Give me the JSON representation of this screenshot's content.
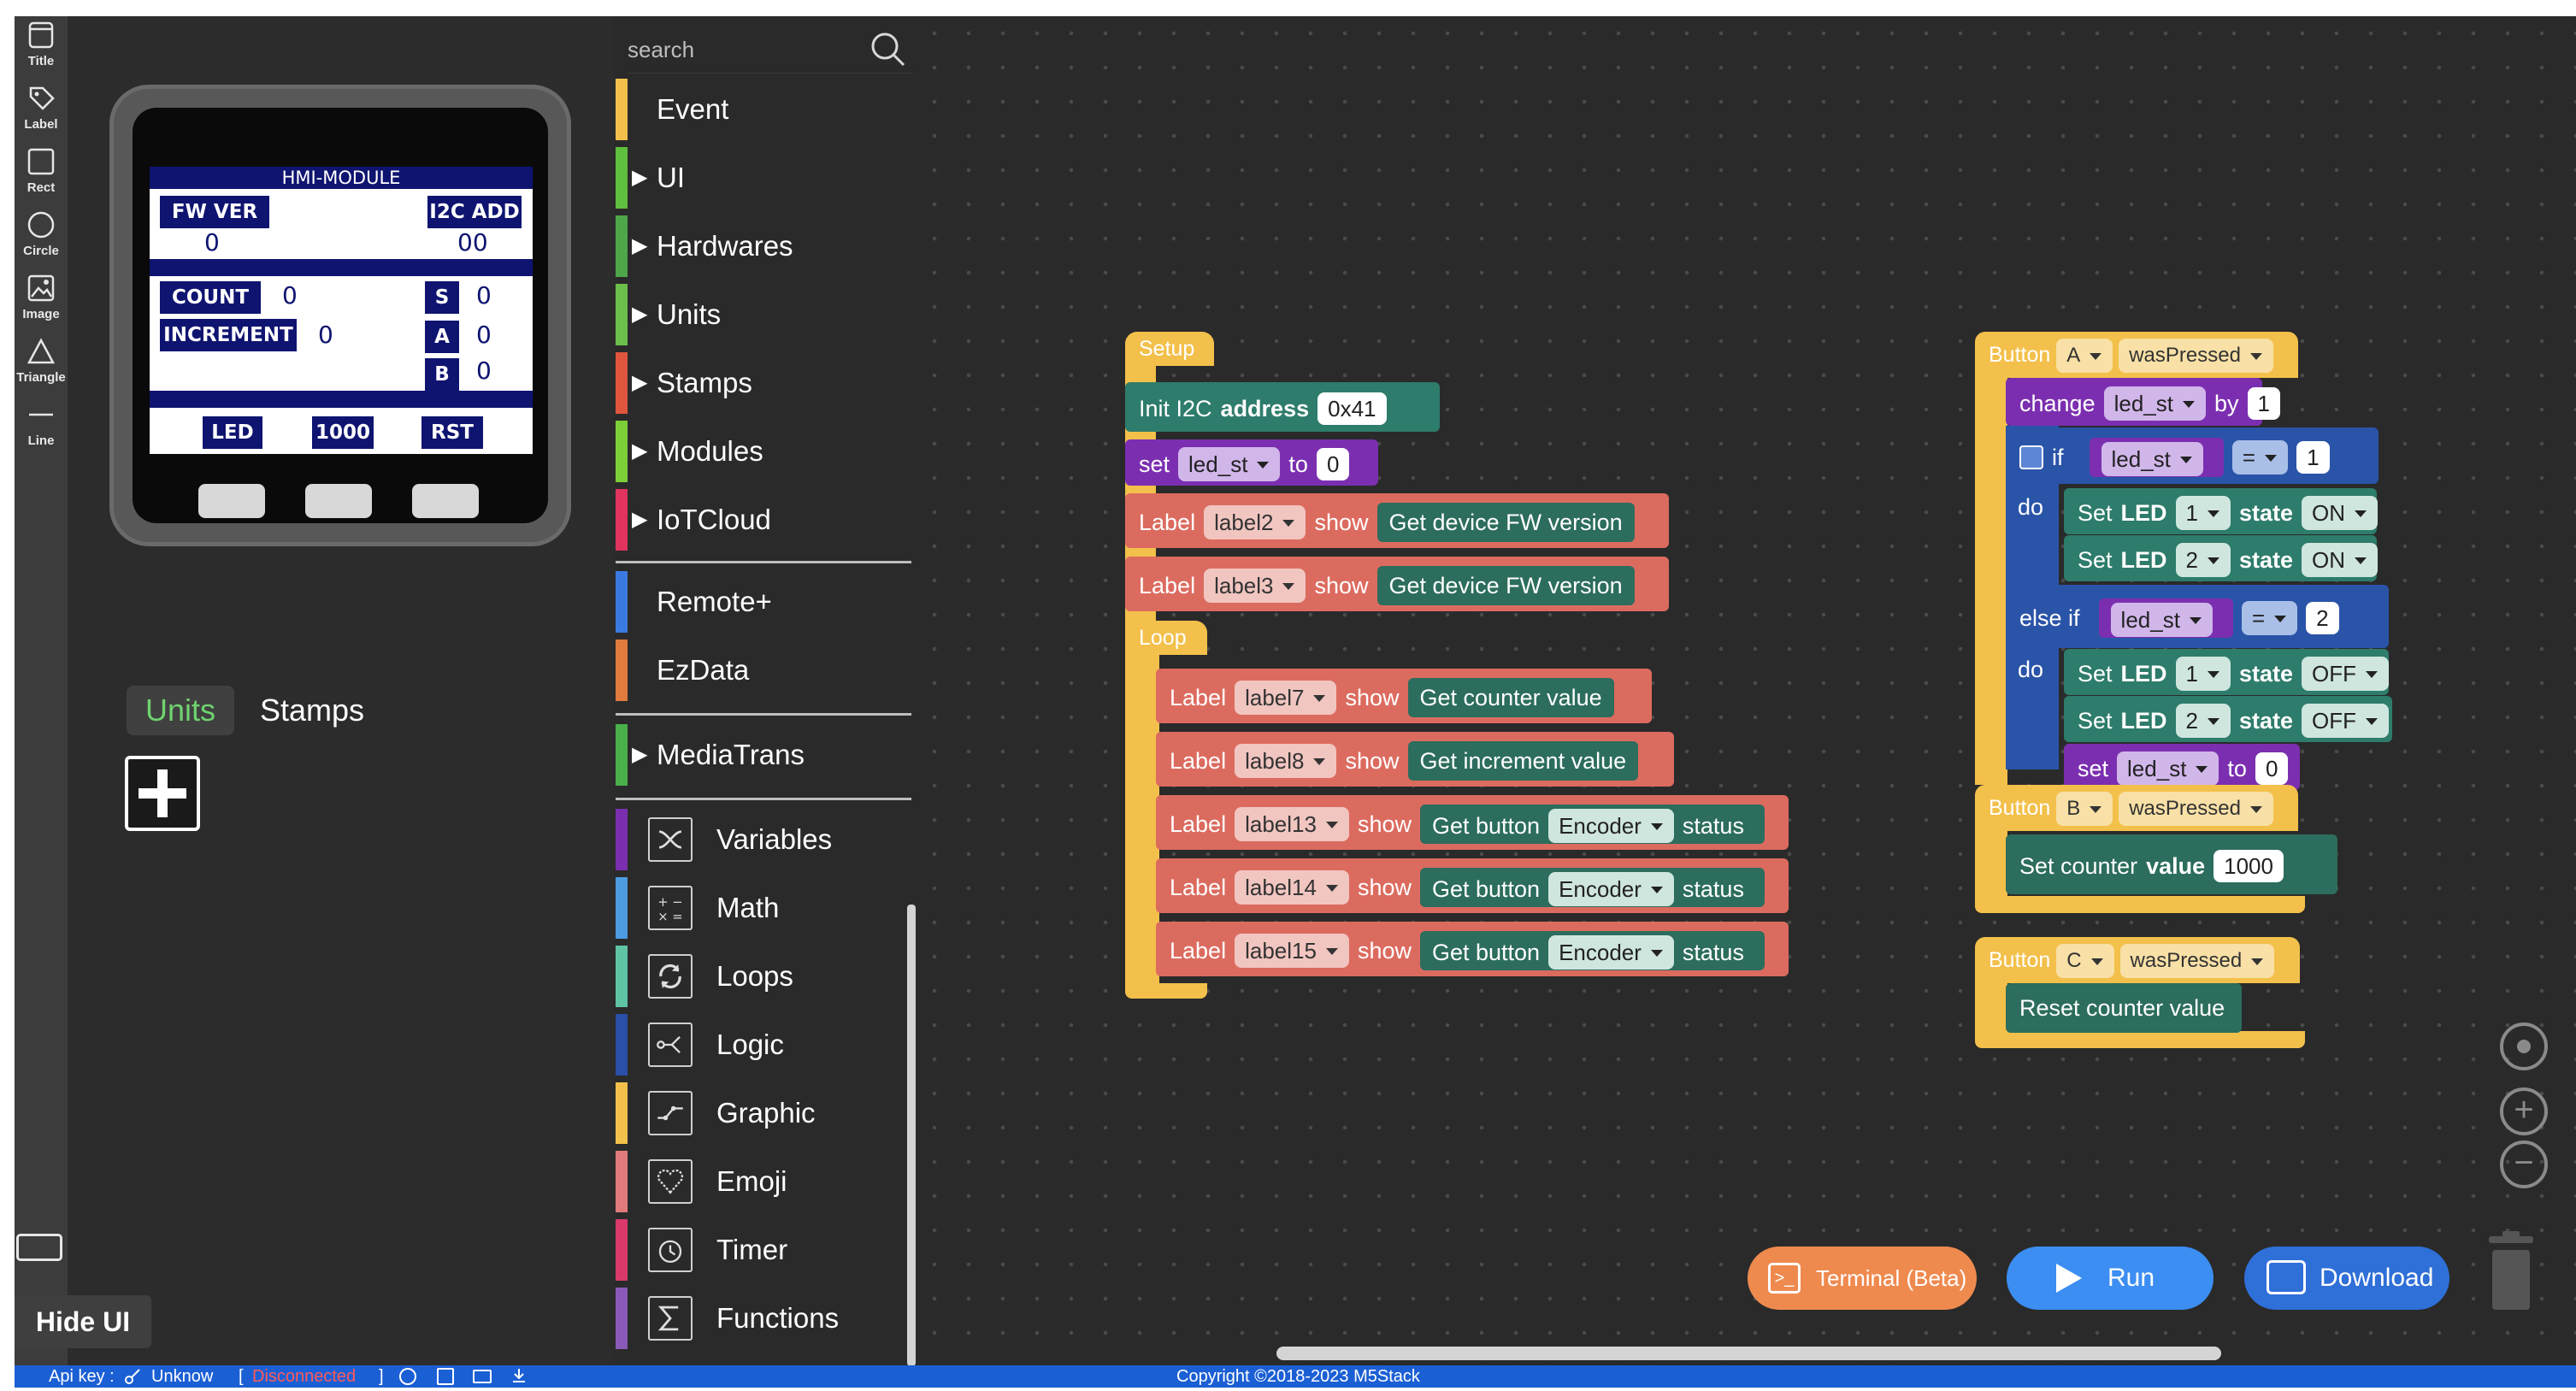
{
  "toolbar": {
    "tools": [
      {
        "label": "Title",
        "icon": "title-icon"
      },
      {
        "label": "Label",
        "icon": "label-icon"
      },
      {
        "label": "Rect",
        "icon": "rect-icon"
      },
      {
        "label": "Circle",
        "icon": "circle-icon"
      },
      {
        "label": "Image",
        "icon": "image-icon"
      },
      {
        "label": "Triangle",
        "icon": "triangle-icon"
      },
      {
        "label": "Line",
        "icon": "line-icon"
      }
    ]
  },
  "device": {
    "title": "HMI-MODULE",
    "fw_ver_label": "FW VER",
    "fw_ver_value": "0",
    "i2c_add_label": "I2C ADD",
    "i2c_add_value": "00",
    "count_label": "COUNT",
    "count_value": "0",
    "increment_label": "INCREMENT",
    "increment_value": "0",
    "s_label": "S",
    "s_value": "0",
    "a_label": "A",
    "a_value": "0",
    "b_label": "B",
    "b_value": "0",
    "led_label": "LED",
    "counter_label": "1000",
    "rst_label": "RST"
  },
  "ui_tabs": {
    "units": "Units",
    "stamps": "Stamps"
  },
  "hide_ui": "Hide UI",
  "search": {
    "placeholder": "search"
  },
  "categories": [
    {
      "label": "Event",
      "color": "#f3c04b",
      "expand": false
    },
    {
      "label": "UI",
      "color": "#5fbf3e",
      "expand": true
    },
    {
      "label": "Hardwares",
      "color": "#4fa64a",
      "expand": true
    },
    {
      "label": "Units",
      "color": "#6bbf4a",
      "expand": true
    },
    {
      "label": "Stamps",
      "color": "#e0553d",
      "expand": true
    },
    {
      "label": "Modules",
      "color": "#7dcf3a",
      "expand": true
    },
    {
      "label": "IoTCloud",
      "color": "#e0345e",
      "expand": true
    },
    {
      "label": "Remote+",
      "color": "#3a7ae0",
      "expand": false
    },
    {
      "label": "EzData",
      "color": "#e07a3d",
      "expand": false
    },
    {
      "label": "MediaTrans",
      "color": "#4ab04a",
      "expand": true
    },
    {
      "label": "Variables",
      "color": "#7b2fb0",
      "icon": "variables-icon"
    },
    {
      "label": "Math",
      "color": "#4c9be0",
      "icon": "math-icon"
    },
    {
      "label": "Loops",
      "color": "#5fc4a6",
      "icon": "loops-icon"
    },
    {
      "label": "Logic",
      "color": "#2a4fa8",
      "icon": "logic-icon"
    },
    {
      "label": "Graphic",
      "color": "#f3c04b",
      "icon": "graphic-icon"
    },
    {
      "label": "Emoji",
      "color": "#e07b7b",
      "icon": "emoji-icon"
    },
    {
      "label": "Timer",
      "color": "#d93a6b",
      "icon": "timer-icon"
    },
    {
      "label": "Functions",
      "color": "#8a5ab8",
      "icon": "functions-icon"
    }
  ],
  "blocks": {
    "setup": "Setup",
    "init_i2c": "Init I2C",
    "address": "address",
    "address_value": "0x41",
    "set": "set",
    "led_st": "led_st",
    "to": "to",
    "zero": "0",
    "label": "Label",
    "show": "show",
    "label2": "label2",
    "label3": "label3",
    "label7": "label7",
    "label8": "label8",
    "label13": "label13",
    "label14": "label14",
    "label15": "label15",
    "get_fw": "Get device FW version",
    "loop": "Loop",
    "get_counter": "Get counter value",
    "get_increment": "Get increment value",
    "get_button": "Get button",
    "encoder": "Encoder",
    "status": "status",
    "button": "Button",
    "btn_a": "A",
    "btn_b": "B",
    "btn_c": "C",
    "was_pressed": "wasPressed",
    "change": "change",
    "by": "by",
    "one": "1",
    "two": "2",
    "if": "if",
    "else_if": "else if",
    "do": "do",
    "eq": "=",
    "set_upper": "Set",
    "led": "LED",
    "state": "state",
    "on": "ON",
    "off": "OFF",
    "set_counter": "Set counter",
    "value": "value",
    "thousand": "1000",
    "reset_counter": "Reset counter value"
  },
  "buttons": {
    "terminal": "Terminal (Beta)",
    "run": "Run",
    "download": "Download"
  },
  "statusbar": {
    "api_key_label": "Api key :",
    "api_key_value": "Unknow",
    "connection_status": "Disconnected",
    "copyright": "Copyright ©2018-2023 M5Stack"
  }
}
